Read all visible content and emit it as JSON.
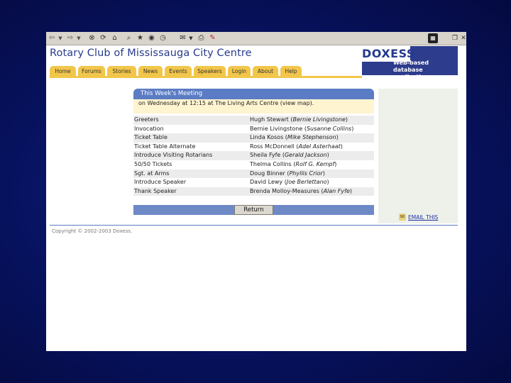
{
  "toolbar": {
    "icons": [
      "back-icon",
      "forward-icon",
      "stop-icon",
      "refresh-icon",
      "home-icon",
      "search-icon",
      "favorites-icon",
      "media-icon",
      "history-icon",
      "mail-icon",
      "print-icon",
      "edit-icon",
      "windows-logo-icon",
      "restore-icon",
      "close-icon"
    ]
  },
  "site": {
    "title": "Rotary Club of Mississauga City Centre",
    "logo_name": "DOXESS",
    "logo_tagline": "Web-based database applications"
  },
  "nav": {
    "items": [
      "Home",
      "Forums",
      "Stories",
      "News",
      "Events",
      "Speakers",
      "Login",
      "About",
      "Help"
    ]
  },
  "meeting": {
    "heading": "This Week's Meeting",
    "info": "on Wednesday at 12:15 at The Living Arts Centre (view map).",
    "rows": [
      {
        "role": "Greeters",
        "name": "Hugh Stewart",
        "alt": "Bernie Livingstone"
      },
      {
        "role": "Invocation",
        "name": "Bernie Livingstone",
        "alt": "Susanne Collins"
      },
      {
        "role": "Ticket Table",
        "name": "Linda Kosos",
        "alt": "Mike Stephenson"
      },
      {
        "role": "Ticket Table Alternate",
        "name": "Ross McDonnell",
        "alt": "Adel Asterhaat"
      },
      {
        "role": "Introduce Visiting Rotarians",
        "name": "Sheila Fyfe",
        "alt": "Gerald Jackson"
      },
      {
        "role": "50/50 Tickets",
        "name": "Thelma Collins",
        "alt": "Rolf G. Kempf"
      },
      {
        "role": "Sgt. at Arms",
        "name": "Doug Binner",
        "alt": "Phyllis Crior"
      },
      {
        "role": "Introduce Speaker",
        "name": "David Lewy",
        "alt": "Joe Berlettano"
      },
      {
        "role": "Thank Speaker",
        "name": "Brenda Molloy-Measures",
        "alt": "Alan Fyfe"
      }
    ],
    "return_label": "Return"
  },
  "email_label": "EMAIL THIS",
  "copyright": "Copyright © 2002-2003 Doxess."
}
